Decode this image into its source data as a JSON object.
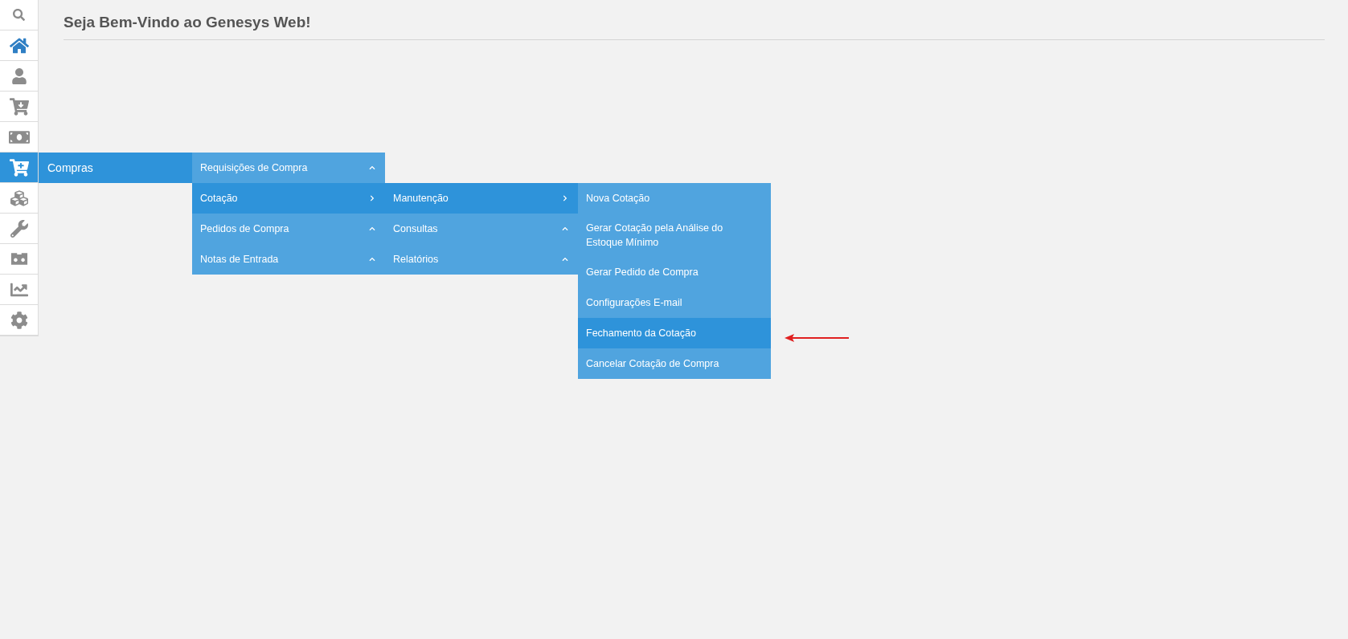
{
  "header": {
    "title": "Seja Bem-Vindo ao Genesys Web!"
  },
  "sidebar": {
    "items": [
      {
        "kind": "search",
        "selected": false,
        "current": false
      },
      {
        "kind": "home",
        "selected": false,
        "current": true
      },
      {
        "kind": "user",
        "selected": false,
        "current": false
      },
      {
        "kind": "cart-down",
        "selected": false,
        "current": false
      },
      {
        "kind": "money",
        "selected": false,
        "current": false
      },
      {
        "kind": "cart-plus",
        "selected": true,
        "current": false,
        "label": "Compras"
      },
      {
        "kind": "cubes",
        "selected": false,
        "current": false
      },
      {
        "kind": "wrench",
        "selected": false,
        "current": false
      },
      {
        "kind": "cassette",
        "selected": false,
        "current": false
      },
      {
        "kind": "chart",
        "selected": false,
        "current": false
      },
      {
        "kind": "gear",
        "selected": false,
        "current": false
      }
    ]
  },
  "menu": [
    {
      "label": "Requisições de Compra",
      "selected": false,
      "expanded": false
    },
    {
      "label": "Cotação",
      "selected": true,
      "expanded": true,
      "children": [
        {
          "label": "Manutenção",
          "selected": true,
          "expanded": true,
          "children": [
            {
              "label": "Nova Cotação",
              "selected": false
            },
            {
              "label": "Gerar Cotação pela Análise do Estoque Mínimo",
              "selected": false
            },
            {
              "label": "Gerar Pedido de Compra",
              "selected": false
            },
            {
              "label": "Configurações E-mail",
              "selected": false
            },
            {
              "label": "Fechamento da Cotação",
              "selected": true
            },
            {
              "label": "Cancelar Cotação de Compra",
              "selected": false
            }
          ]
        },
        {
          "label": "Consultas",
          "selected": false,
          "expanded": false
        },
        {
          "label": "Relatórios",
          "selected": false,
          "expanded": false
        }
      ]
    },
    {
      "label": "Pedidos de Compra",
      "selected": false,
      "expanded": false
    },
    {
      "label": "Notas de Entrada",
      "selected": false,
      "expanded": false
    }
  ],
  "annotation": {
    "kind": "arrow"
  }
}
